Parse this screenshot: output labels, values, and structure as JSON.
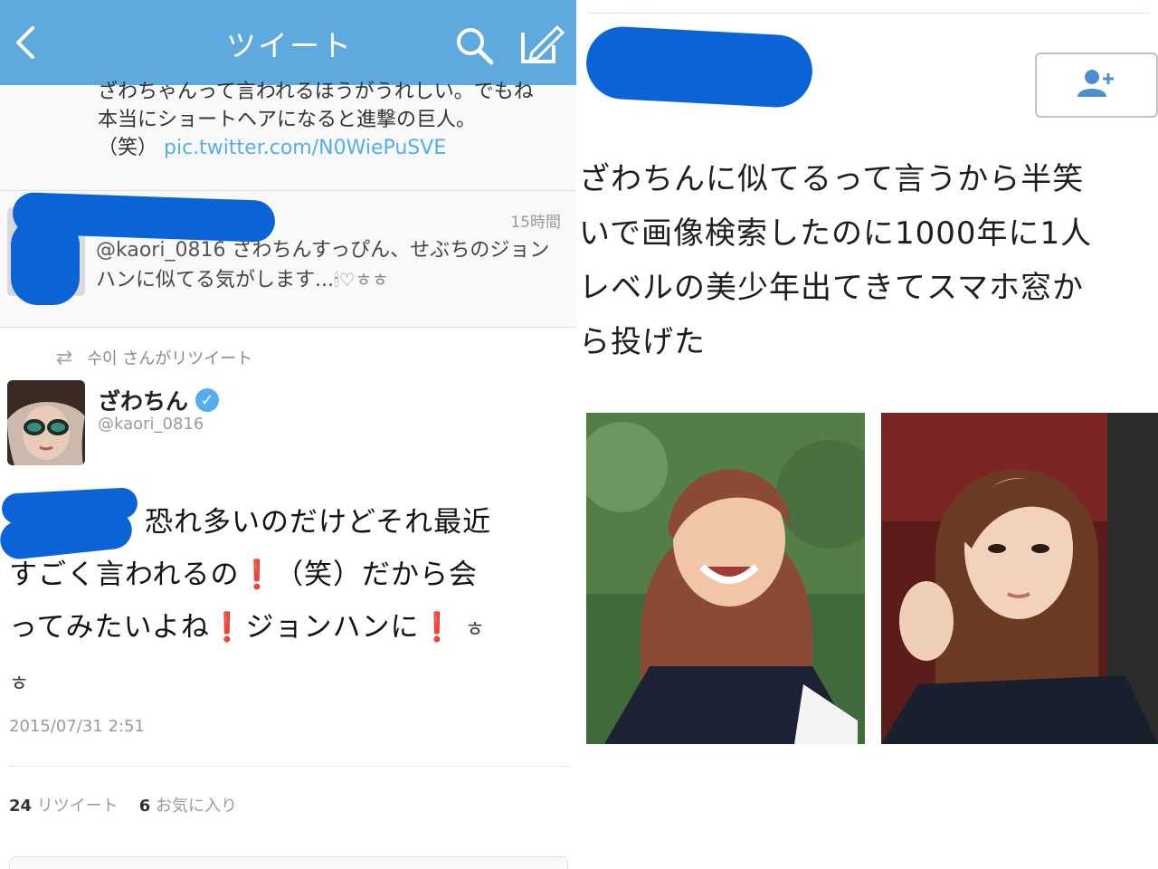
{
  "left_screen": {
    "nav": {
      "title": "ツイート",
      "back_icon": "chevron-left-icon",
      "search_icon": "search-icon",
      "compose_icon": "compose-icon",
      "bar_color": "#5ea9dd"
    },
    "snippet": {
      "line1": "ざわちゃんって言われるほうがうれしい。でもね",
      "line2": "本当にショートヘアになると進撃の巨人。",
      "line3_prefix": "（笑）",
      "link": "pic.twitter.com/N0WiePuSVE"
    },
    "reply": {
      "time": "15時間",
      "handle": "@kaori_0816",
      "text": "ざわちんすっぴん、せぶちのジョンハンに似てる気がします...",
      "emoji": "🕯♡ㅎㅎ"
    },
    "tweet": {
      "retweeted_by": "수이 さんがリツイート",
      "author_name": "ざわちん",
      "author_handle": "@kaori_0816",
      "body_line1": "恐れ多いのだけどそれ最近",
      "body_line2a": "すごく言われるの",
      "body_line2b": "（笑）だから会",
      "body_line3a": "ってみたいよね",
      "body_line3b": "ジョンハンに",
      "body_line3c": "ㅎ",
      "body_line4": "ㅎ",
      "exclaim": "❗",
      "date": "2015/07/31 2:51",
      "retweet_count": "24",
      "retweet_label": "リツイート",
      "fav_count": "6",
      "fav_label": "お気に入り"
    }
  },
  "right_screen": {
    "follow_icon": "add-user-icon",
    "text_line1": "ざわちんに似てるって言うから半笑",
    "text_line2": "いで画像検索したのに1000年に1人",
    "text_line3": "レベルの美少年出てきてスマホ窓か",
    "text_line4": "ら投げた"
  },
  "colors": {
    "accent_blue": "#55acee",
    "scribble_blue": "#0b63d8",
    "exclaim_red": "#d62d2d"
  }
}
